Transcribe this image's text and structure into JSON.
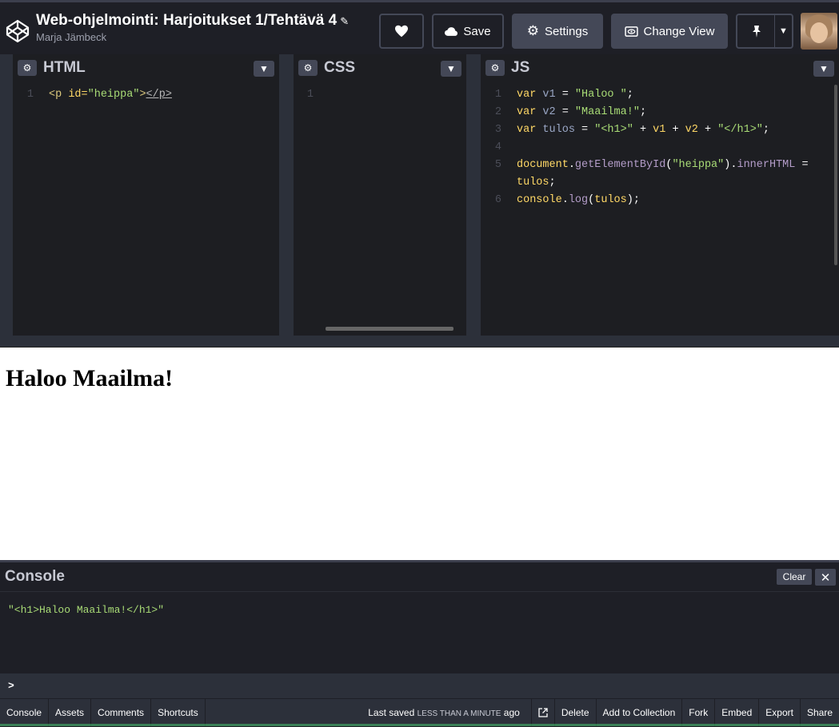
{
  "header": {
    "title": "Web-ohjelmointi: Harjoitukset 1/Tehtävä 4",
    "author": "Marja Jämbeck",
    "save_label": "Save",
    "settings_label": "Settings",
    "change_view_label": "Change View"
  },
  "panes": {
    "html": {
      "title": "HTML"
    },
    "css": {
      "title": "CSS"
    },
    "js": {
      "title": "JS"
    }
  },
  "html_code": {
    "line1_num": "1",
    "line1_open": "<p ",
    "line1_attr": "id=",
    "line1_val": "\"heippa\"",
    "line1_close": ">",
    "line1_end": "</p>"
  },
  "css_code": {
    "line1_num": "1"
  },
  "js_code": {
    "nums": [
      "1",
      "2",
      "3",
      "4",
      "5",
      "6"
    ],
    "l1": [
      "var",
      " v1 ",
      "= ",
      "\"Haloo \"",
      ";"
    ],
    "l2": [
      "var",
      " v2 ",
      "= ",
      "\"Maailma!\"",
      ";"
    ],
    "l3": [
      "var",
      " tulos ",
      "= ",
      "\"<h1>\"",
      " + ",
      "v1",
      " + ",
      "v2",
      " + ",
      "\"</h1>\"",
      ";"
    ],
    "l5a": [
      "document",
      ".",
      "getElementById",
      "(",
      "\"heippa\"",
      ").",
      "innerHTML",
      " ="
    ],
    "l5b": [
      "tulos",
      ";"
    ],
    "l6": [
      "console",
      ".",
      "log",
      "(",
      "tulos",
      ");"
    ]
  },
  "preview": {
    "heading": "Haloo Maailma!"
  },
  "console": {
    "title": "Console",
    "clear_label": "Clear",
    "output": "\"<h1>Haloo Maailma!</h1>\"",
    "prompt": ">"
  },
  "footer": {
    "left": [
      "Console",
      "Assets",
      "Comments",
      "Shortcuts"
    ],
    "saved_prefix": "Last saved",
    "saved_time": "LESS THAN A MINUTE",
    "saved_suffix": "ago",
    "right": [
      "Delete",
      "Add to Collection",
      "Fork",
      "Embed",
      "Export",
      "Share"
    ]
  },
  "colors": {
    "accent_green": "#47cf73",
    "bg": "#1e1f26",
    "button_gray": "#444857"
  },
  "icons": [
    "codepen-logo-icon",
    "pencil-icon",
    "heart-icon",
    "cloud-icon",
    "gear-icon",
    "eye-view-icon",
    "pin-icon",
    "chevron-down-icon",
    "close-icon",
    "external-link-icon"
  ]
}
